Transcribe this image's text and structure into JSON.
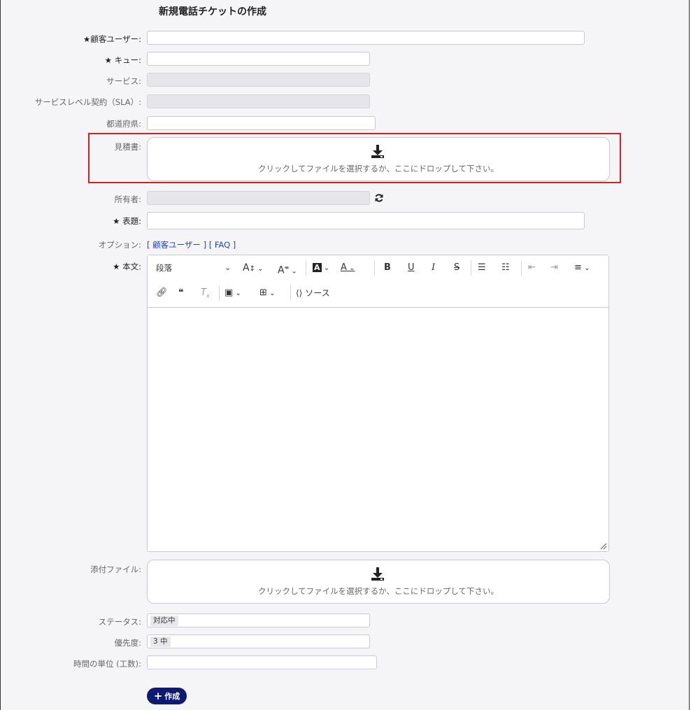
{
  "form": {
    "title": "新規電話チケットの作成",
    "fields": {
      "customer_user": {
        "label": "顧客ユーザー:",
        "value": ""
      },
      "queue": {
        "label": "キュー:",
        "value": ""
      },
      "service": {
        "label": "サービス:",
        "value": ""
      },
      "sla": {
        "label": "サービスレベル契約（SLA）:",
        "value": ""
      },
      "prefecture": {
        "label": "都道府県:",
        "value": ""
      },
      "estimate": {
        "label": "見積書:"
      },
      "owner": {
        "label": "所有者:",
        "value": ""
      },
      "subject": {
        "label": "表題:",
        "value": ""
      },
      "options": {
        "label": "オプション:",
        "link_customer": "[ 顧客ユーザー ]",
        "link_faq": "[ FAQ ]"
      },
      "body": {
        "label": "本文:"
      },
      "attachment": {
        "label": "添付ファイル:"
      },
      "status": {
        "label": "ステータス:",
        "value": "対応中"
      },
      "priority": {
        "label": "優先度:",
        "value": "3 中"
      },
      "time_units": {
        "label": "時間の単位 (工数):",
        "value": ""
      }
    },
    "required_mark": "★",
    "dropzone_text": "クリックしてファイルを選択するか、ここにドロップして下さい。",
    "editor": {
      "paragraph_label": "段落",
      "source_label": "ソース"
    },
    "create_button": "作成"
  },
  "colors": {
    "accent": "#0d1a73",
    "highlight": "#d91e1e",
    "link": "#1a3fd0"
  }
}
